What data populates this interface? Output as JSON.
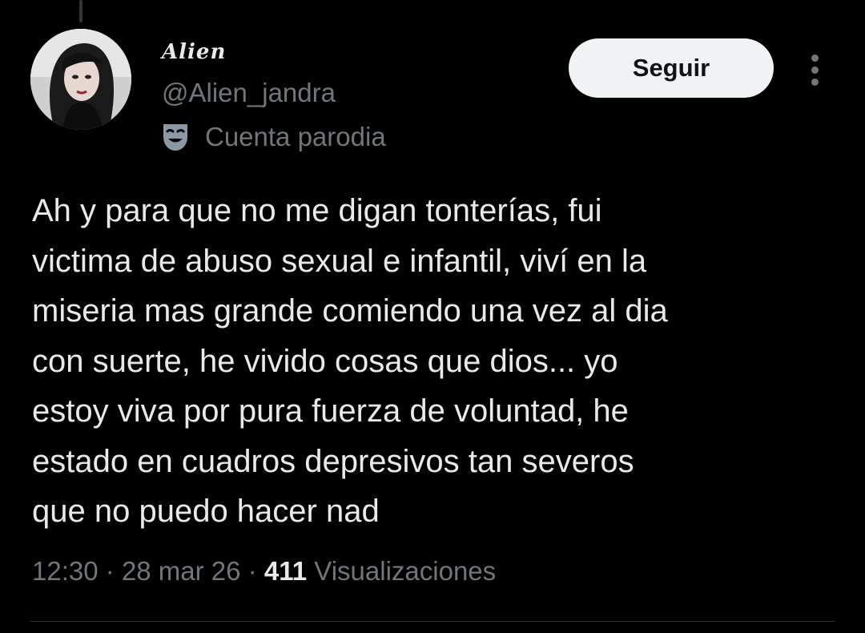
{
  "author": {
    "display_name": "Alien",
    "handle": "@Alien_jandra",
    "parody_label": "Cuenta parodia",
    "parody_icon": "theater-mask-icon",
    "avatar_icon": "profile-photo"
  },
  "actions": {
    "follow_label": "Seguir",
    "more_icon": "more-vertical-icon"
  },
  "tweet": {
    "text_lines": [
      "Ah y para que no me digan tonterías, fui",
      "victima de abuso sexual e infantil, viví en la",
      "miseria mas grande comiendo una vez al dia",
      "con suerte, he vivido cosas que dios... yo",
      "estoy viva por pura fuerza de voluntad, he",
      "estado en cuadros depresivos tan severos",
      "que no puedo hacer nad"
    ]
  },
  "meta": {
    "time": "12:30",
    "separator": "·",
    "date": "28 mar 26",
    "views_count": "411",
    "views_label": "Visualizaciones"
  },
  "colors": {
    "background": "#000000",
    "primary_text": "#e7e9ea",
    "secondary_text": "#71767b",
    "button_bg": "#eff3f4",
    "button_text": "#0f1419",
    "divider": "#2f3336"
  }
}
